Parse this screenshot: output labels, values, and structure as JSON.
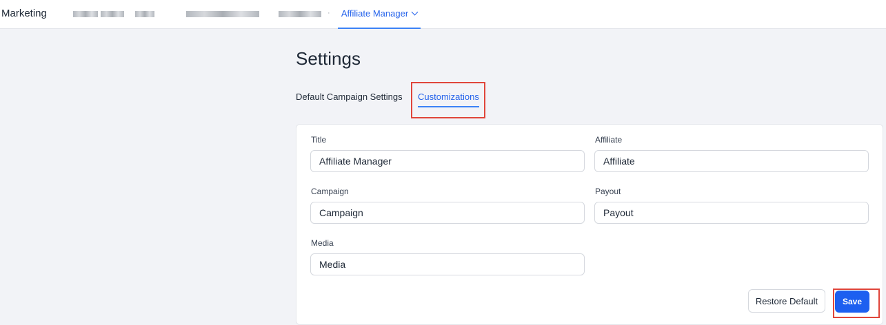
{
  "topbar": {
    "brand": "Marketing",
    "active_nav": "Affiliate Manager"
  },
  "page": {
    "title": "Settings",
    "tabs": [
      {
        "label": "Default Campaign Settings",
        "active": false
      },
      {
        "label": "Customizations",
        "active": true
      }
    ]
  },
  "form": {
    "fields": [
      {
        "label": "Title",
        "value": "Affiliate Manager"
      },
      {
        "label": "Affiliate",
        "value": "Affiliate"
      },
      {
        "label": "Campaign",
        "value": "Campaign"
      },
      {
        "label": "Payout",
        "value": "Payout"
      },
      {
        "label": "Media",
        "value": "Media"
      }
    ],
    "restore_label": "Restore Default",
    "save_label": "Save"
  },
  "colors": {
    "accent": "#2563eb",
    "primary_button": "#1d5ff0",
    "highlight_box": "#e0453a",
    "background": "#f2f3f7"
  },
  "icons": {
    "nav_dropdown": "chevron-down-icon"
  }
}
